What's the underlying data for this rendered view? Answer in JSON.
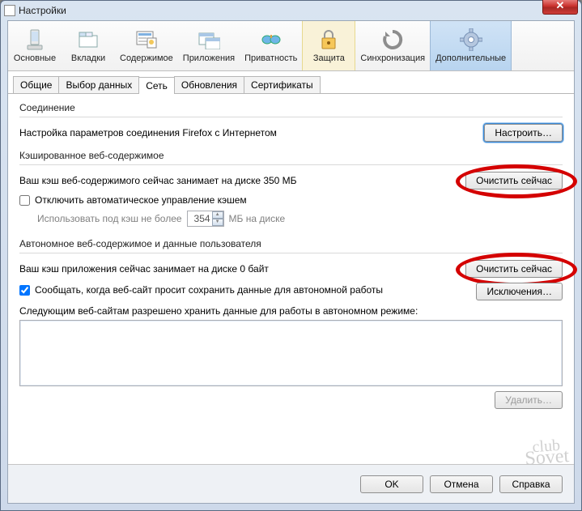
{
  "window": {
    "title": "Настройки"
  },
  "categories": [
    {
      "label": "Основные"
    },
    {
      "label": "Вкладки"
    },
    {
      "label": "Содержимое"
    },
    {
      "label": "Приложения"
    },
    {
      "label": "Приватность"
    },
    {
      "label": "Защита"
    },
    {
      "label": "Синхронизация"
    },
    {
      "label": "Дополнительные"
    }
  ],
  "tabs": [
    {
      "label": "Общие"
    },
    {
      "label": "Выбор данных"
    },
    {
      "label": "Сеть"
    },
    {
      "label": "Обновления"
    },
    {
      "label": "Сертификаты"
    }
  ],
  "connection": {
    "group": "Соединение",
    "desc": "Настройка параметров соединения Firefox с Интернетом",
    "configure": "Настроить…"
  },
  "cache": {
    "group": "Кэшированное веб-содержимое",
    "status": "Ваш кэш веб-содержимого сейчас занимает на диске 350 МБ",
    "clear": "Очистить сейчас",
    "override_chk": "Отключить автоматическое управление кэшем",
    "limit_label_pre": "Использовать под кэш не более",
    "limit_value": "354",
    "limit_label_post": "МБ на диске"
  },
  "offline": {
    "group": "Автономное веб-содержимое и данные пользователя",
    "status": "Ваш кэш приложения сейчас занимает на диске 0 байт",
    "clear": "Очистить сейчас",
    "notify_chk": "Сообщать, когда веб-сайт просит сохранить данные для автономной работы",
    "exceptions": "Исключения…",
    "sites_label": "Следующим веб-сайтам разрешено хранить данные для работы в автономном режиме:",
    "delete": "Удалить…"
  },
  "footer": {
    "ok": "OK",
    "cancel": "Отмена",
    "help": "Справка"
  }
}
